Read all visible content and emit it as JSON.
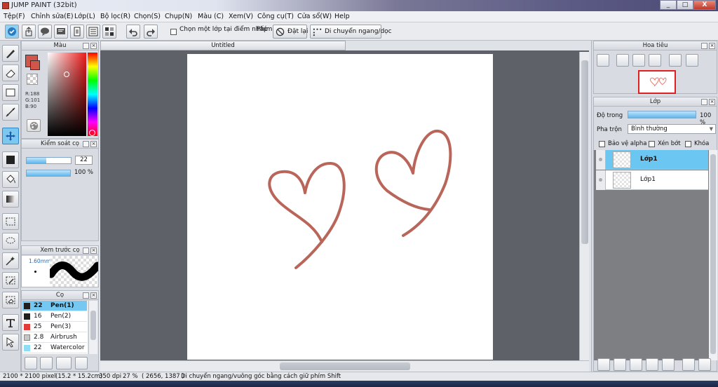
{
  "window": {
    "title": "JUMP PAINT (32bit)",
    "minimize": "_",
    "restore": "□",
    "close": "X"
  },
  "menu": {
    "items": [
      "Tệp(F)",
      "Chỉnh sửa(E)",
      "Lớp(L)",
      "Bộ lọc(R)",
      "Chọn(S)",
      "Chụp(N)",
      "Màu (C)",
      "Xem(V)",
      "Công cụ(T)",
      "Cửa sổ(W)",
      "Help"
    ]
  },
  "toolbar": {
    "pick_layer_label": "Chọn một lớp tại điểm nhấp",
    "key_label": "Phím",
    "reset_label": "Đặt lại",
    "move_label": "Di chuyển ngang/dọc"
  },
  "color_panel": {
    "title": "Màu",
    "rgb_r": "R:188",
    "rgb_g": "G:101",
    "rgb_b": "B:90",
    "fg_color": "#d0554a",
    "bg_color": "#ffffff"
  },
  "brush_control": {
    "title": "Kiểm soát cọ",
    "size": "22",
    "opacity": "100 %"
  },
  "brush_preview": {
    "title": "Xem trước cọ",
    "size_label": "1.60mm"
  },
  "brushes": {
    "title": "Cọ",
    "items": [
      {
        "size": "22",
        "name": "Pen(1)",
        "color": "#1f1f1f"
      },
      {
        "size": "16",
        "name": "Pen(2)",
        "color": "#1f1f1f"
      },
      {
        "size": "25",
        "name": "Pen(3)",
        "color": "#e23b3b"
      },
      {
        "size": "2.8",
        "name": "Airbrush",
        "color": "#c6c6c6"
      },
      {
        "size": "22",
        "name": "Watercolor (",
        "color": "#8fdcf5"
      }
    ]
  },
  "document": {
    "tab": "Untitled",
    "stroke_color": "#b9655a"
  },
  "navigator": {
    "title": "Hoa tiêu"
  },
  "layers": {
    "title": "Lớp",
    "opacity_label": "Độ trong",
    "opacity_value": "100 %",
    "opacity_level": 1.0,
    "blend_label": "Pha trộn",
    "blend_value": "Bình thường",
    "protect_alpha": "Bảo vệ alpha",
    "clipping": "Xén bớt",
    "lock": "Khóa",
    "items": [
      {
        "name": "Lớp1"
      },
      {
        "name": "Lớp1"
      }
    ]
  },
  "status": {
    "size": "2100 * 2100 pixel",
    "cm": "(15.2 * 15.2cm)",
    "dpi": "350 dpi",
    "zoom": "27 %",
    "coords": "( 2656, 1387 )",
    "hint": "Di chuyển ngang/vuông góc bằng cách giữ phím Shift"
  }
}
